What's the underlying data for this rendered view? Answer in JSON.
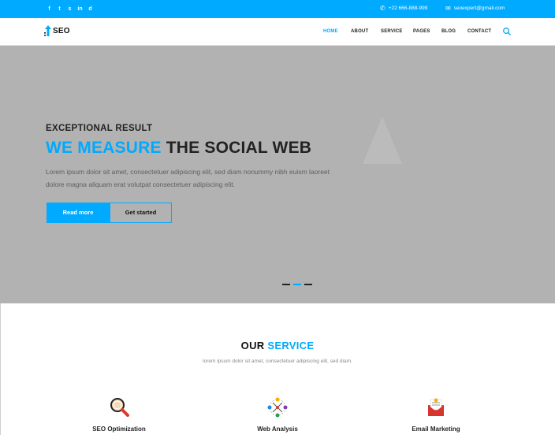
{
  "topbar": {
    "social_icons": [
      "facebook-icon",
      "twitter-icon",
      "skype-icon",
      "linkedin-icon",
      "dribbble-icon"
    ],
    "social_glyphs": [
      "f",
      "t",
      "s",
      "in",
      "d"
    ],
    "phone": "+22 666-888-999",
    "email": "seoexpert@gmail.com"
  },
  "nav": {
    "logo_text": "SEO",
    "items": [
      {
        "label": "HOME",
        "active": true
      },
      {
        "label": "ABOUT"
      },
      {
        "label": "SERVICE"
      },
      {
        "label": "PAGES"
      },
      {
        "label": "BLOG"
      },
      {
        "label": "CONTACT"
      }
    ]
  },
  "hero": {
    "eyebrow": "EXCEPTIONAL RESULT",
    "title_highlight": "WE MEASURE",
    "title_rest": " THE SOCIAL WEB",
    "description": "Lorem ipsum dolor sit amet, consectetuer adipiscing elit, sed diam nonummy nibh euism laoreet dolore magna aliquam erat volutpat consectetuer adipiscing elit.",
    "primary_button": "Read more",
    "secondary_button": "Get started",
    "slides": 3,
    "active_slide": 2
  },
  "services": {
    "title_prefix": "OUR ",
    "title_highlight": "SERVICE",
    "subtitle": "lorem ipsum dolor sit amet, consectetuer adipiscing elit, sed diam.",
    "items": [
      {
        "name": "SEO Optimization",
        "icon": "magnifier-icon"
      },
      {
        "name": "Web Analysis",
        "icon": "analysis-network-icon"
      },
      {
        "name": "Email Marketing",
        "icon": "email-envelope-icon"
      }
    ]
  },
  "colors": {
    "accent": "#00aaff",
    "hero_bg": "#b2b2b2",
    "dark_text": "#222222"
  }
}
